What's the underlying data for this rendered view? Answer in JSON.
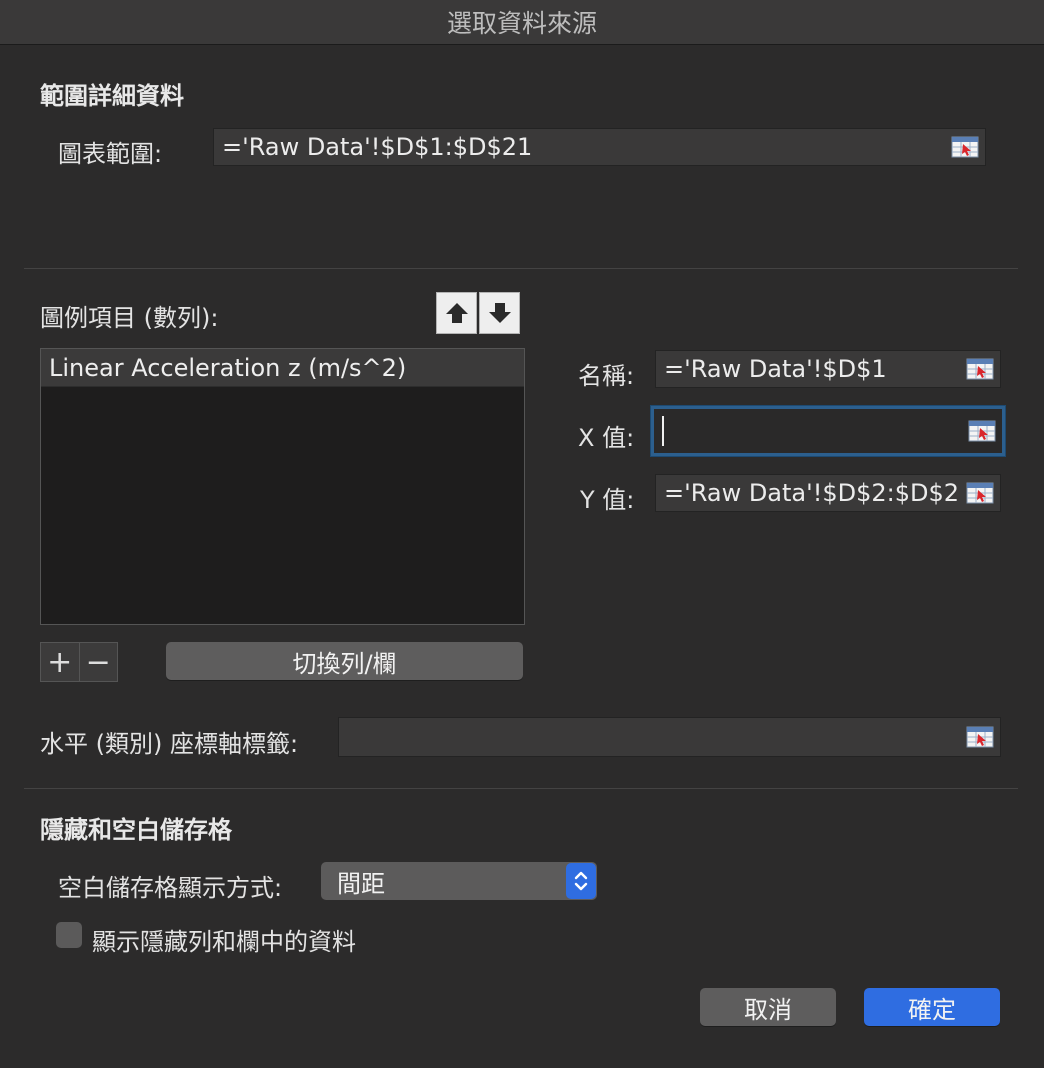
{
  "window": {
    "title": "選取資料來源"
  },
  "range_section": {
    "title": "範圍詳細資料",
    "chart_range_label": "圖表範圍:",
    "chart_range_value": "='Raw Data'!$D$1:$D$21"
  },
  "legend_section": {
    "label": "圖例項目 (數列):",
    "series": [
      "Linear Acceleration z (m/s^2)"
    ],
    "add_label": "+",
    "remove_label": "−",
    "switch_label": "切換列/欄"
  },
  "series_fields": {
    "name_label": "名稱:",
    "name_value": "='Raw Data'!$D$1",
    "x_label": "X 值:",
    "x_value": "",
    "y_label": "Y 值:",
    "y_value": "='Raw Data'!$D$2:$D$2"
  },
  "horizontal_axis": {
    "label": "水平 (類別) 座標軸標籤:",
    "value": ""
  },
  "hidden_section": {
    "title": "隱藏和空白儲存格",
    "empty_cells_label": "空白儲存格顯示方式:",
    "empty_cells_value": "間距",
    "show_hidden_label": "顯示隱藏列和欄中的資料",
    "show_hidden_checked": false
  },
  "buttons": {
    "cancel": "取消",
    "ok": "確定"
  },
  "colors": {
    "accent": "#2f6de1",
    "focus_ring": "#2c5f8e"
  }
}
